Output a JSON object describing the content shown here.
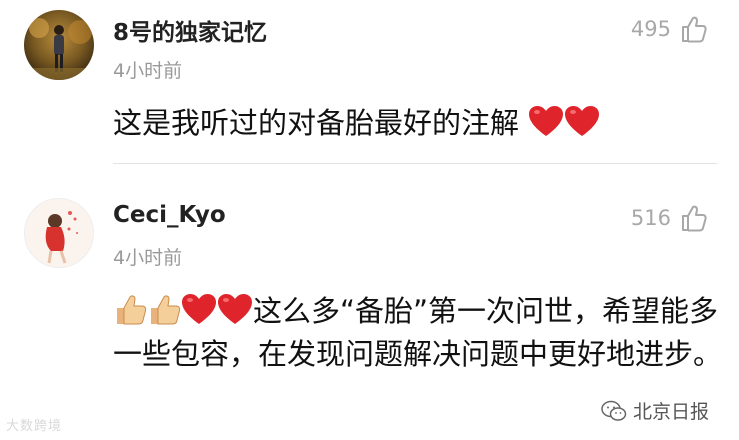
{
  "comments": [
    {
      "username": "8号的独家记忆",
      "time": "4小时前",
      "likes": "495",
      "text": "这是我听过的对备胎最好的注解",
      "emoji": [
        "heart",
        "heart"
      ]
    },
    {
      "username": "Ceci_Kyo",
      "time": "4小时前",
      "likes": "516",
      "emoji_prefix": [
        "thumbs-up",
        "thumbs-up",
        "heart",
        "heart"
      ],
      "text": "这么多“备胎”第一次问世，希望能多一些包容，在发现问题解决问题中更好地进步。"
    }
  ],
  "watermark": {
    "left": "大数跨境",
    "right": "北京日报"
  },
  "colors": {
    "heart": "#e0242b",
    "muted": "#9a9a9a",
    "divider": "#e3e3e3"
  }
}
